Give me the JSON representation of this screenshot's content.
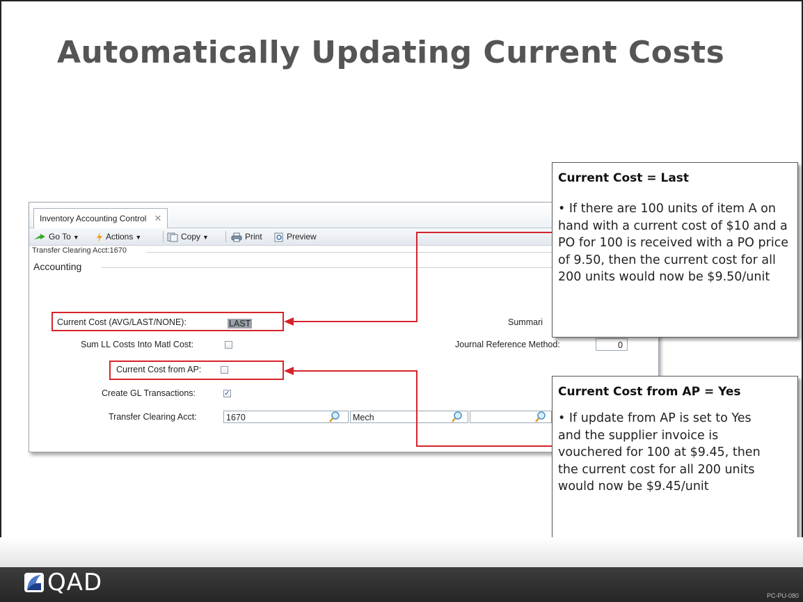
{
  "slide": {
    "title": "Automatically Updating Current Costs",
    "code": "PC-PU-080",
    "logo_text": "QAD"
  },
  "window": {
    "tab_label": "Inventory Accounting Control",
    "tab_close": "✕",
    "toolbar": {
      "goto": "Go To",
      "actions": "Actions",
      "copy": "Copy",
      "print": "Print",
      "preview": "Preview"
    },
    "breadcrumb": "Transfer Clearing Acct:1670",
    "group": "Accounting",
    "fields": {
      "current_cost_label": "Current Cost (AVG/LAST/NONE):",
      "current_cost_value": "LAST",
      "sum_ll_label": "Sum LL Costs Into Matl Cost:",
      "sum_ll_checked": false,
      "cc_from_ap_label": "Current Cost from AP:",
      "cc_from_ap_checked": false,
      "create_gl_label": "Create GL Transactions:",
      "create_gl_checked": true,
      "create_gl_mark": "✓",
      "transfer_acct_label": "Transfer Clearing Acct:",
      "transfer_acct_value": "1670",
      "sub_acct_value": "Mech",
      "cost_center_value": "",
      "summarize_label": "Summari",
      "journal_ref_label": "Journal Reference Method:",
      "journal_ref_value": "0"
    }
  },
  "callouts": {
    "last": {
      "heading": "Current Cost = Last",
      "body": "• If there are 100 units of item A on hand with a current cost of $10 and a PO for 100 is received with a PO price of 9.50, then the current cost for all 200 units would now be $9.50/unit"
    },
    "ap": {
      "heading": "Current Cost from AP = Yes",
      "body": "• If update from AP is set to Yes and the supplier invoice is vouchered for 100 at $9.45, then the current cost for all 200 units would now be $9.45/unit"
    }
  },
  "colors": {
    "highlight_red": "#d6232a",
    "title_gray": "#555555"
  }
}
